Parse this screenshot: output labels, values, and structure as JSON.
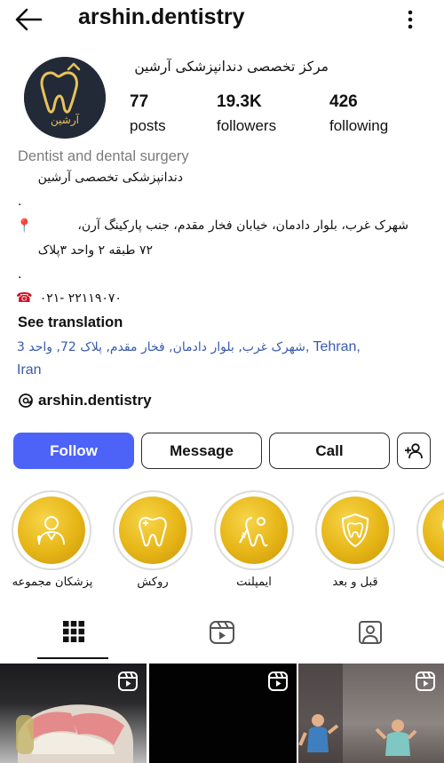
{
  "header": {
    "username": "arshin.dentistry"
  },
  "profile": {
    "avatar_text": "آرشین",
    "display_name": "مرکز تخصصی دندانپزشکی آرشین",
    "stats": [
      {
        "value": "77",
        "label": "posts"
      },
      {
        "value": "19.3K",
        "label": "followers"
      },
      {
        "value": "426",
        "label": "following"
      }
    ]
  },
  "bio": {
    "category": "Dentist and dental surgery",
    "line1": "دندانپزشکی تخصصی آرشین",
    "dot1": ".",
    "address_line1": "شهرک غرب، بلوار دادمان، خیابان فخار مقدم، جنب پارکینگ آرن،",
    "address_line2": "۷۲ طبقه ۲ واحد ۳پلاک",
    "dot2": ".",
    "phone": "۰۲۱- ۲۲۱۱۹۰۷۰",
    "see_translation": "See translation",
    "location_fa": "شهرک غرب, بلوار دادمان, فخار مقدم, پلاک 72, واحد 3",
    "location_en": ", Tehran,",
    "location_country": "Iran",
    "threads_handle": "arshin.dentistry"
  },
  "actions": {
    "follow": "Follow",
    "message": "Message",
    "call": "Call"
  },
  "highlights": [
    {
      "label": "پزشکان مجموعه",
      "icon": "doctor-icon"
    },
    {
      "label": "روکش",
      "icon": "tooth-crown-icon"
    },
    {
      "label": "ایمپلنت",
      "icon": "implant-icon"
    },
    {
      "label": "قبل و بعد",
      "icon": "tooth-shield-icon"
    },
    {
      "label": "",
      "icon": "tooth-icon"
    }
  ],
  "tabs": [
    {
      "name": "grid",
      "icon": "grid-icon",
      "active": true
    },
    {
      "name": "reels",
      "icon": "reels-icon",
      "active": false
    },
    {
      "name": "tagged",
      "icon": "tagged-icon",
      "active": false
    }
  ],
  "colors": {
    "follow_button": "#4d63f8",
    "link": "#3a5aab",
    "highlight_gold": "#e6b516",
    "avatar_bg": "#222a38"
  }
}
